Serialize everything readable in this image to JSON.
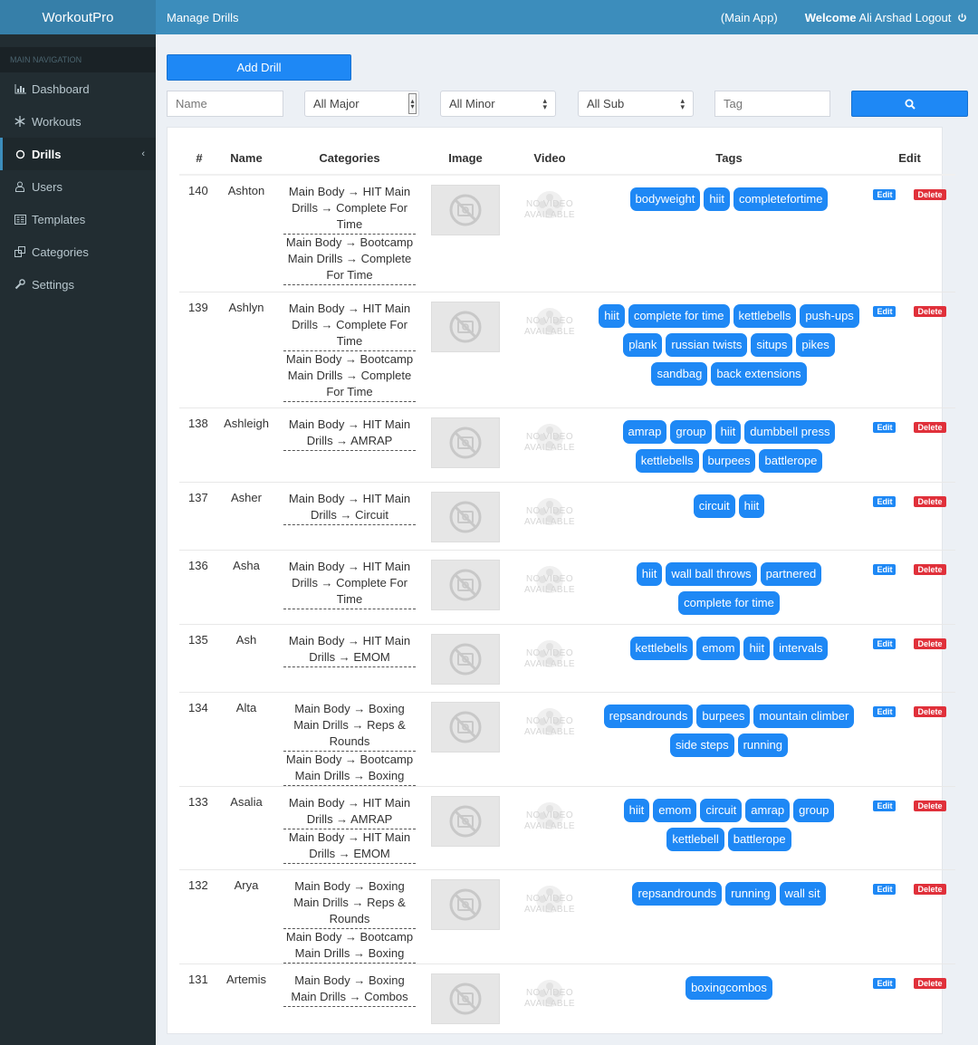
{
  "app": {
    "brand": "WorkoutPro"
  },
  "header": {
    "title": "Manage Drills",
    "main_app": "(Main App)",
    "welcome": "Welcome",
    "user": "Ali Arshad",
    "logout": "Logout"
  },
  "sidebar": {
    "header": "MAIN NAVIGATION",
    "items": [
      {
        "label": "Dashboard",
        "icon": "bar-chart-icon"
      },
      {
        "label": "Workouts",
        "icon": "snowflake-icon"
      },
      {
        "label": "Drills",
        "icon": "circle-icon",
        "active": true
      },
      {
        "label": "Users",
        "icon": "user-icon"
      },
      {
        "label": "Templates",
        "icon": "template-icon"
      },
      {
        "label": "Categories",
        "icon": "categories-icon"
      },
      {
        "label": "Settings",
        "icon": "wrench-icon"
      }
    ]
  },
  "toolbar": {
    "add_label": "Add Drill",
    "name_placeholder": "Name",
    "major_value": "All Major",
    "minor_value": "All Minor",
    "sub_value": "All Sub",
    "tag_placeholder": "Tag"
  },
  "table": {
    "columns": [
      "#",
      "Name",
      "Categories",
      "Image",
      "Video",
      "Tags",
      "Edit"
    ],
    "video_placeholder": [
      "NO VIDEO",
      "AVAILABLE"
    ],
    "edit_label": "Edit",
    "delete_label": "Delete",
    "rows": [
      {
        "id": "140",
        "name": "Ashton",
        "categories": [
          "Main Body → HIT Main Drills → Complete For Time",
          "Main Body → Bootcamp Main Drills → Complete For Time"
        ],
        "tags": [
          "bodyweight",
          "hiit",
          "completefortime"
        ]
      },
      {
        "id": "139",
        "name": "Ashlyn",
        "categories": [
          "Main Body → HIT Main Drills → Complete For Time",
          "Main Body → Bootcamp Main Drills → Complete For Time"
        ],
        "tags": [
          "hiit",
          "complete for time",
          "kettlebells",
          "push-ups",
          "plank",
          "russian twists",
          "situps",
          "pikes",
          "sandbag",
          "back extensions"
        ]
      },
      {
        "id": "138",
        "name": "Ashleigh",
        "categories": [
          "Main Body → HIT Main Drills → AMRAP"
        ],
        "tags": [
          "amrap",
          "group",
          "hiit",
          "dumbbell press",
          "kettlebells",
          "burpees",
          "battlerope"
        ]
      },
      {
        "id": "137",
        "name": "Asher",
        "categories": [
          "Main Body → HIT Main Drills → Circuit"
        ],
        "tags": [
          "circuit",
          "hiit"
        ]
      },
      {
        "id": "136",
        "name": "Asha",
        "categories": [
          "Main Body → HIT Main Drills → Complete For Time"
        ],
        "tags": [
          "hiit",
          "wall ball throws",
          "partnered",
          "complete for time"
        ]
      },
      {
        "id": "135",
        "name": "Ash",
        "categories": [
          "Main Body → HIT Main Drills → EMOM"
        ],
        "tags": [
          "kettlebells",
          "emom",
          "hiit",
          "intervals"
        ]
      },
      {
        "id": "134",
        "name": "Alta",
        "categories": [
          "Main Body → Boxing Main Drills → Reps & Rounds",
          "Main Body → Bootcamp Main Drills → Boxing"
        ],
        "tags": [
          "repsandrounds",
          "burpees",
          "mountain climber",
          "side steps",
          "running"
        ]
      },
      {
        "id": "133",
        "name": "Asalia",
        "categories": [
          "Main Body → HIT Main Drills → AMRAP",
          "Main Body → HIT Main Drills → EMOM"
        ],
        "tags": [
          "hiit",
          "emom",
          "circuit",
          "amrap",
          "group",
          "kettlebell",
          "battlerope"
        ]
      },
      {
        "id": "132",
        "name": "Arya",
        "categories": [
          "Main Body → Boxing Main Drills → Reps & Rounds",
          "Main Body → Bootcamp Main Drills → Boxing"
        ],
        "tags": [
          "repsandrounds",
          "running",
          "wall sit"
        ]
      },
      {
        "id": "131",
        "name": "Artemis",
        "categories": [
          "Main Body → Boxing Main Drills → Combos"
        ],
        "tags": [
          "boxingcombos"
        ]
      }
    ]
  },
  "colors": {
    "primary": "#1e88f5",
    "danger": "#e0303a",
    "sidebar": "#222d32",
    "header": "#3c8dbc"
  }
}
